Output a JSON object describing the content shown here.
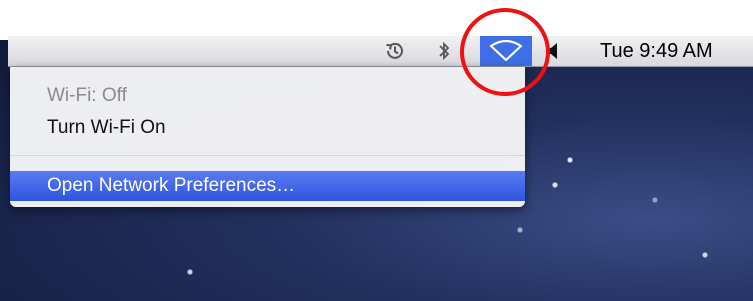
{
  "menubar": {
    "icons": [
      "time-machine-icon",
      "bluetooth-icon",
      "wifi-icon",
      "volume-icon"
    ],
    "clock": "Tue 9:49 AM",
    "wifi_highlight_color": "#3f6fe6"
  },
  "wifi_menu": {
    "status": "Wi-Fi: Off",
    "turn_on": "Turn Wi-Fi On",
    "open_prefs": "Open Network Preferences…",
    "selected_item_color": "#2f54e0"
  },
  "annotation": {
    "color": "#ee1111",
    "shape": "circle"
  }
}
